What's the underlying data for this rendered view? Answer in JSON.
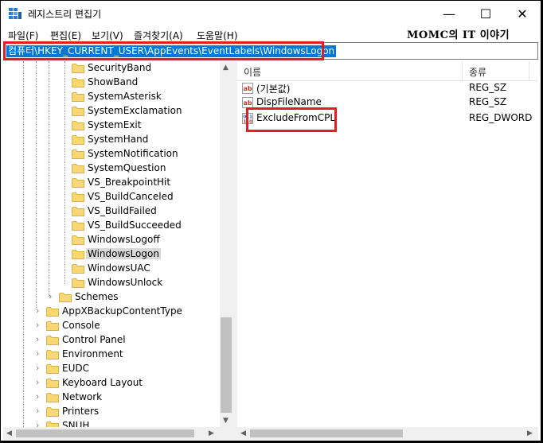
{
  "window": {
    "title": "레지스트리 편집기",
    "controls": {
      "minimize": "—",
      "maximize": "☐",
      "close": "✕"
    }
  },
  "menu": [
    "파일(F)",
    "편집(E)",
    "보기(V)",
    "즐겨찾기(A)",
    "도움말(H)"
  ],
  "watermark": "MOMC의 IT 이야기",
  "address": {
    "path": "컴퓨터\\HKEY_CURRENT_USER\\AppEvents\\EventLabels\\WindowsLogon"
  },
  "tree": {
    "event_labels": [
      "SecurityBand",
      "ShowBand",
      "SystemAsterisk",
      "SystemExclamation",
      "SystemExit",
      "SystemHand",
      "SystemNotification",
      "SystemQuestion",
      "VS_BreakpointHit",
      "VS_BuildCanceled",
      "VS_BuildFailed",
      "VS_BuildSucceeded",
      "WindowsLogoff",
      "WindowsLogon",
      "WindowsUAC",
      "WindowsUnlock"
    ],
    "selected": "WindowsLogon",
    "schemes": "Schemes",
    "top_keys": [
      "AppXBackupContentType",
      "Console",
      "Control Panel",
      "Environment",
      "EUDC",
      "Keyboard Layout",
      "Network",
      "Printers",
      "SNUH"
    ]
  },
  "values": {
    "columns": {
      "name": "이름",
      "type": "종류"
    },
    "rows": [
      {
        "name": "(기본값)",
        "type": "REG_SZ",
        "icon": "string-value-icon"
      },
      {
        "name": "DispFileName",
        "type": "REG_SZ",
        "icon": "string-value-icon"
      },
      {
        "name": "ExcludeFromCPL",
        "type": "REG_DWORD",
        "icon": "binary-value-icon"
      }
    ]
  },
  "colors": {
    "highlight": "#e51c23",
    "selection": "#0078d7",
    "folder": "#f8d775"
  }
}
